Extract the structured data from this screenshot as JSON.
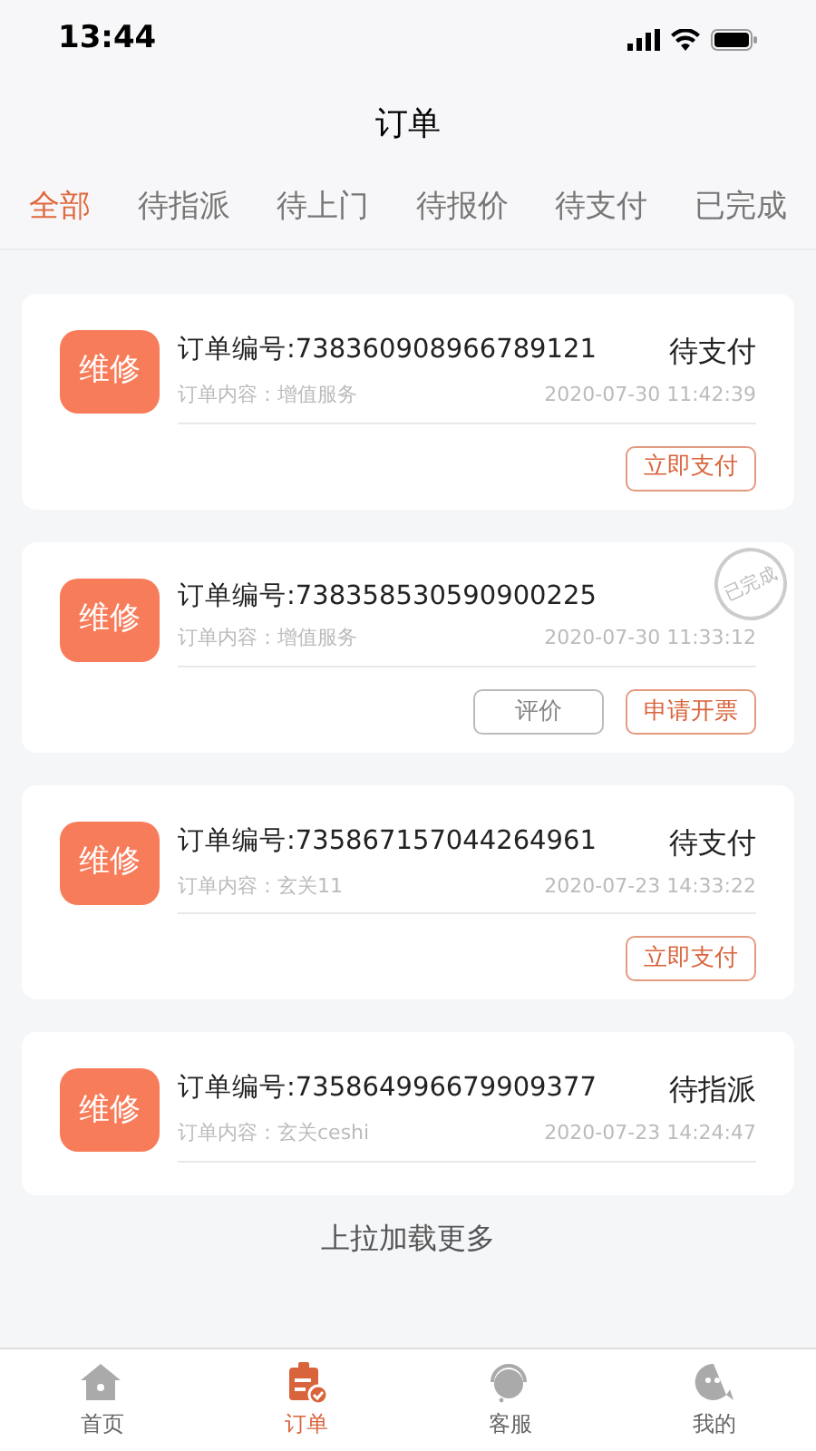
{
  "status_bar": {
    "time": "13:44"
  },
  "nav": {
    "title": "订单"
  },
  "tabs": [
    {
      "label": "全部",
      "selected": true
    },
    {
      "label": "待指派",
      "selected": false
    },
    {
      "label": "待上门",
      "selected": false
    },
    {
      "label": "待报价",
      "selected": false
    },
    {
      "label": "待支付",
      "selected": false
    },
    {
      "label": "已完成",
      "selected": false
    }
  ],
  "orders": [
    {
      "badge": "维修",
      "order_no": "订单编号:738360908966789121",
      "status": "待支付",
      "content": "订单内容：增值服务",
      "time": "2020-07-30 11:42:39",
      "buttons": [
        {
          "label": "立即支付",
          "kind": "primary"
        }
      ]
    },
    {
      "badge": "维修",
      "order_no": "订单编号:738358530590900225",
      "stamp": "已完成",
      "content": "订单内容：增值服务",
      "time": "2020-07-30 11:33:12",
      "buttons": [
        {
          "label": "评价",
          "kind": "secondary"
        },
        {
          "label": "申请开票",
          "kind": "primary"
        }
      ]
    },
    {
      "badge": "维修",
      "order_no": "订单编号:735867157044264961",
      "status": "待支付",
      "content": "订单内容：玄关11",
      "time": "2020-07-23 14:33:22",
      "buttons": [
        {
          "label": "立即支付",
          "kind": "primary"
        }
      ]
    },
    {
      "badge": "维修",
      "order_no": "订单编号:735864996679909377",
      "status": "待指派",
      "content": "订单内容：玄关ceshi",
      "time": "2020-07-23 14:24:47"
    }
  ],
  "load_more": "上拉加载更多",
  "bottom_nav": [
    {
      "label": "首页",
      "kind": "home",
      "selected": false
    },
    {
      "label": "订单",
      "kind": "orders",
      "selected": true
    },
    {
      "label": "客服",
      "kind": "service",
      "selected": false
    },
    {
      "label": "我的",
      "kind": "profile",
      "selected": false
    }
  ]
}
